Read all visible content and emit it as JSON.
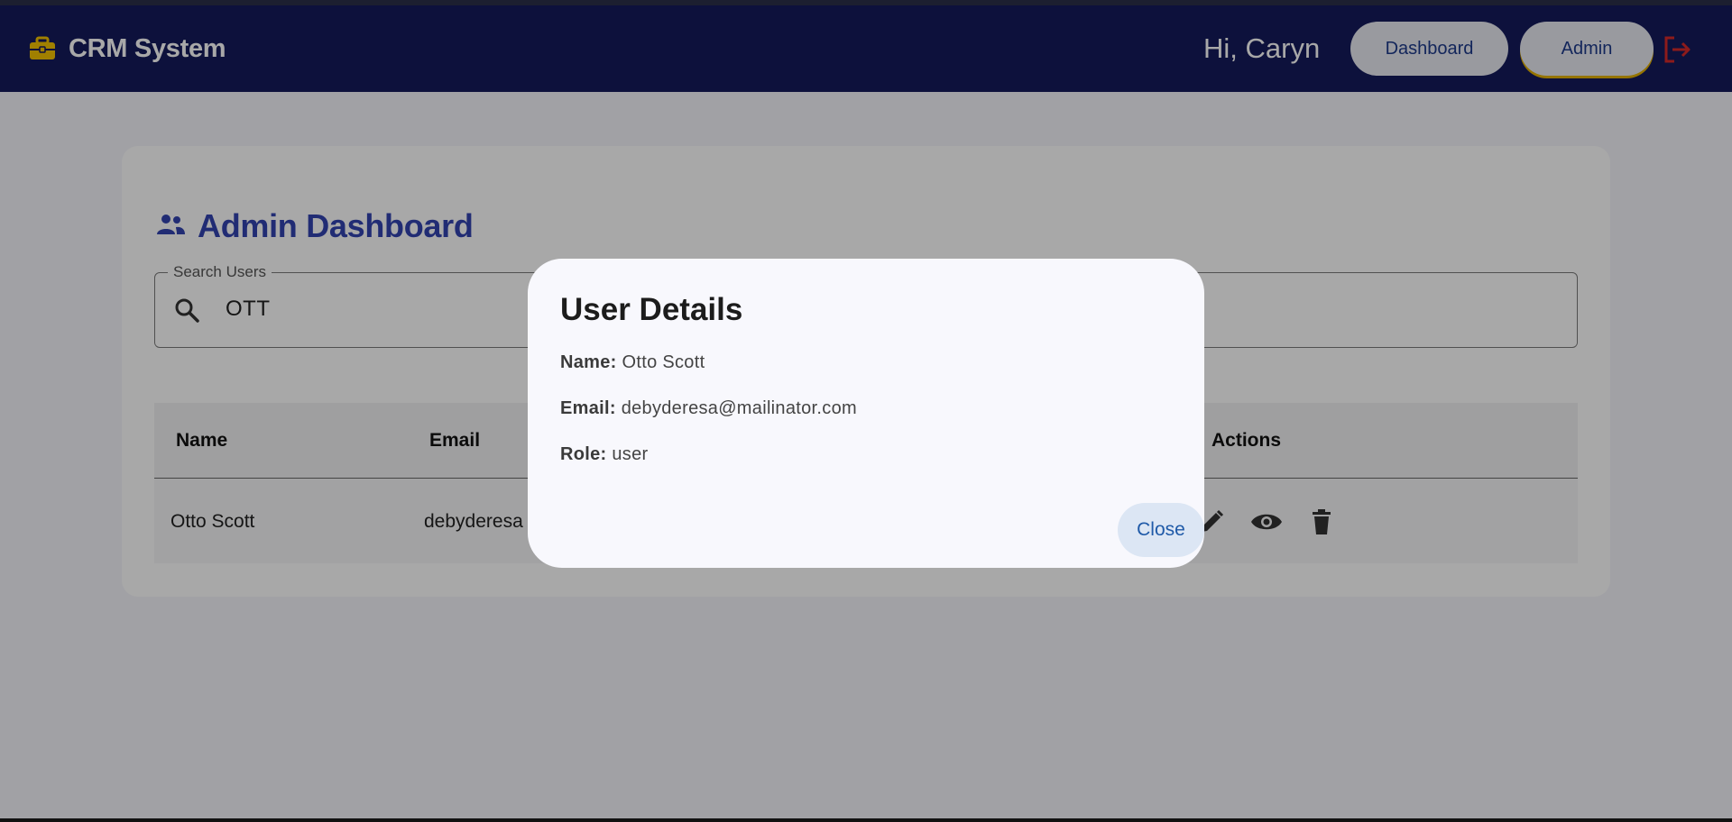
{
  "header": {
    "brand_icon": "briefcase-icon",
    "brand_title": "CRM System",
    "greeting": "Hi, Caryn",
    "dashboard_label": "Dashboard",
    "admin_label": "Admin",
    "logout_icon": "logout-icon",
    "brand_color": "#141a5c",
    "accent_yellow": "#e2b100"
  },
  "main": {
    "title_icon": "users-icon",
    "title": "Admin Dashboard",
    "search": {
      "label": "Search Users",
      "value": "OTT",
      "icon": "search-icon"
    },
    "table": {
      "columns": [
        "Name",
        "Email",
        "Actions"
      ],
      "rows": [
        {
          "name": "Otto Scott",
          "email": "debyderesa",
          "actions": [
            "edit-icon",
            "eye-icon",
            "delete-icon"
          ]
        }
      ]
    }
  },
  "dialog": {
    "title": "User Details",
    "name_label": "Name:",
    "name_value": "Otto Scott",
    "email_label": "Email:",
    "email_value": "debyderesa@mailinator.com",
    "role_label": "Role:",
    "role_value": "user",
    "close_label": "Close"
  }
}
